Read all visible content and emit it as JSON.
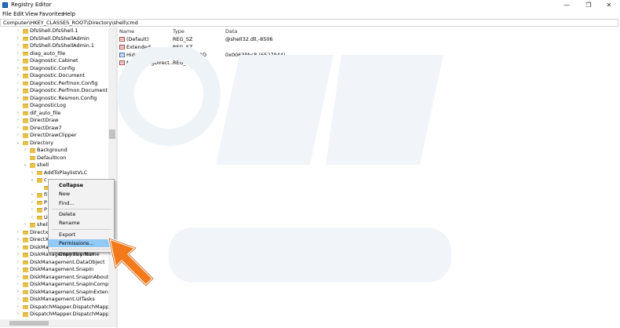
{
  "window": {
    "title": "Registry Editor",
    "minimize_glyph": "—",
    "maximize_glyph": "❐",
    "close_glyph": "✕"
  },
  "menu": [
    "File",
    "Edit",
    "View",
    "Favorites",
    "Help"
  ],
  "address": "Computer\\HKEY_CLASSES_ROOT\\Directory\\shell\\cmd",
  "tree": [
    {
      "label": "DfsShell.DfsShell.1",
      "arrow": "›",
      "indent": 0
    },
    {
      "label": "DfsShell.DfsShellAdmin",
      "arrow": "›",
      "indent": 0
    },
    {
      "label": "DfsShell.DfsShellAdmin.1",
      "arrow": "›",
      "indent": 0
    },
    {
      "label": "diag_auto_file",
      "arrow": "›",
      "indent": 0
    },
    {
      "label": "Diagnostic.Cabinet",
      "arrow": "›",
      "indent": 0
    },
    {
      "label": "Diagnostic.Config",
      "arrow": "›",
      "indent": 0
    },
    {
      "label": "Diagnostic.Document",
      "arrow": "›",
      "indent": 0
    },
    {
      "label": "Diagnostic.Perfmon.Config",
      "arrow": "›",
      "indent": 0
    },
    {
      "label": "Diagnostic.Perfmon.Document",
      "arrow": "›",
      "indent": 0
    },
    {
      "label": "Diagnostic.Resmon.Config",
      "arrow": "›",
      "indent": 0
    },
    {
      "label": "DiagnosticLog",
      "arrow": "",
      "indent": 0
    },
    {
      "label": "dif_auto_file",
      "arrow": "›",
      "indent": 0
    },
    {
      "label": "DirectDraw",
      "arrow": "›",
      "indent": 0
    },
    {
      "label": "DirectDraw7",
      "arrow": "›",
      "indent": 0
    },
    {
      "label": "DirectDrawClipper",
      "arrow": "›",
      "indent": 0
    },
    {
      "label": "Directory",
      "arrow": "⌄",
      "indent": 0
    },
    {
      "label": "Background",
      "arrow": "›",
      "indent": 1
    },
    {
      "label": "DefaultIcon",
      "arrow": "",
      "indent": 1
    },
    {
      "label": "shell",
      "arrow": "⌄",
      "indent": 1
    },
    {
      "label": "AddToPlaylistVLC",
      "arrow": "›",
      "indent": 2
    },
    {
      "label": "c",
      "arrow": "⌄",
      "indent": 2
    },
    {
      "label": "",
      "arrow": "",
      "indent": 3
    },
    {
      "label": "fi",
      "arrow": "›",
      "indent": 2
    },
    {
      "label": "P",
      "arrow": "›",
      "indent": 2
    },
    {
      "label": "P",
      "arrow": "›",
      "indent": 2
    },
    {
      "label": "U",
      "arrow": "›",
      "indent": 2
    },
    {
      "label": "shell",
      "arrow": "›",
      "indent": 1
    },
    {
      "label": "Directx",
      "arrow": "›",
      "indent": 0
    },
    {
      "label": "DirectX",
      "arrow": "›",
      "indent": 0
    },
    {
      "label": "DiskMa",
      "arrow": "›",
      "indent": 0
    },
    {
      "label": "DiskManagement.Control",
      "arrow": "›",
      "indent": 0
    },
    {
      "label": "DiskManagement.DataObject",
      "arrow": "›",
      "indent": 0
    },
    {
      "label": "DiskManagement.SnapIn",
      "arrow": "›",
      "indent": 0
    },
    {
      "label": "DiskManagement.SnapInAbout",
      "arrow": "›",
      "indent": 0
    },
    {
      "label": "DiskManagement.SnapInCompor",
      "arrow": "›",
      "indent": 0
    },
    {
      "label": "DiskManagement.SnapInExtensic",
      "arrow": "›",
      "indent": 0
    },
    {
      "label": "DiskManagement.UITasks",
      "arrow": "›",
      "indent": 0
    },
    {
      "label": "DispatchMapper.DispatchMappe",
      "arrow": "›",
      "indent": 0
    },
    {
      "label": "DispatchMapper.DispatchMappe",
      "arrow": "›",
      "indent": 0
    }
  ],
  "columns": {
    "name": "Name",
    "type": "Type",
    "data": "Data"
  },
  "values": [
    {
      "name": "(Default)",
      "type": "REG_SZ",
      "data": "@shell32.dll,-8506",
      "icon": "ab"
    },
    {
      "name": "Extended",
      "type": "REG_SZ",
      "data": "",
      "icon": "ab"
    },
    {
      "name": "HideBasedOnVel...",
      "type": "REG_DWORD",
      "data": "0x00639bc8 (6527944)",
      "icon": "bin"
    },
    {
      "name": "NoWorkingDirect...",
      "type": "REG_SZ",
      "data": "",
      "icon": "ab"
    }
  ],
  "context_menu": [
    {
      "label": "Collapse",
      "bold": true
    },
    {
      "label": "New",
      "submenu": true
    },
    {
      "label": "Find..."
    },
    {
      "sep": true
    },
    {
      "label": "Delete"
    },
    {
      "label": "Rename"
    },
    {
      "sep": true
    },
    {
      "label": "Export"
    },
    {
      "label": "Permissions...",
      "highlight": true
    },
    {
      "sep": true
    },
    {
      "label": "Copy Key Name"
    }
  ],
  "colors": {
    "accent": "#91c9f7",
    "folder": "#e8c04a",
    "pointer": "#f27a1a",
    "watermark": "#eef3f8"
  }
}
